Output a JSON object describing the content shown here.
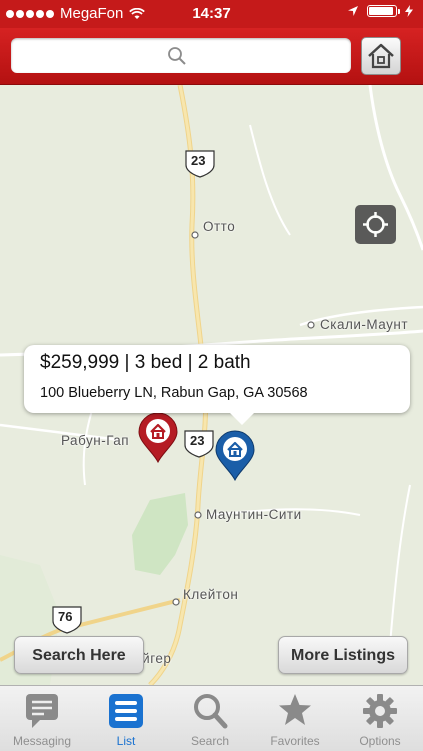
{
  "status_bar": {
    "carrier": "MegaFon",
    "time": "14:37",
    "signal_dots": 5,
    "battery_level": 0.95
  },
  "nav_bar": {
    "search_placeholder": "",
    "home_button_icon": "home-icon"
  },
  "map": {
    "labels": {
      "otto": "Отто",
      "skali": "Скали-Маунт",
      "rabun": "Рабун-Гап",
      "mountain_city": "Маунтин-Сити",
      "clayton": "Клейтон",
      "tiger": "Тайгер"
    },
    "route_shields": {
      "us23_top": "23",
      "us23_mid": "23",
      "us76": "76"
    },
    "locate_icon": "crosshair-icon"
  },
  "listing_callout": {
    "summary": "$259,999 | 3 bed | 2 bath",
    "address": "100 Blueberry LN, Rabun Gap, GA 30568"
  },
  "buttons": {
    "search_here": "Search Here",
    "more_listings": "More Listings"
  },
  "tab_bar": {
    "tabs": [
      {
        "label": "Messaging",
        "icon": "chat-icon",
        "active": false
      },
      {
        "label": "List",
        "icon": "list-icon",
        "active": true
      },
      {
        "label": "Search",
        "icon": "search-icon",
        "active": false
      },
      {
        "label": "Favorites",
        "icon": "star-icon",
        "active": false
      },
      {
        "label": "Options",
        "icon": "gear-icon",
        "active": false
      }
    ]
  },
  "colors": {
    "brand_red": "#c51a1a",
    "pin_red": "#b51c24",
    "pin_blue": "#1b5ea8",
    "tab_active": "#1a72d0"
  }
}
